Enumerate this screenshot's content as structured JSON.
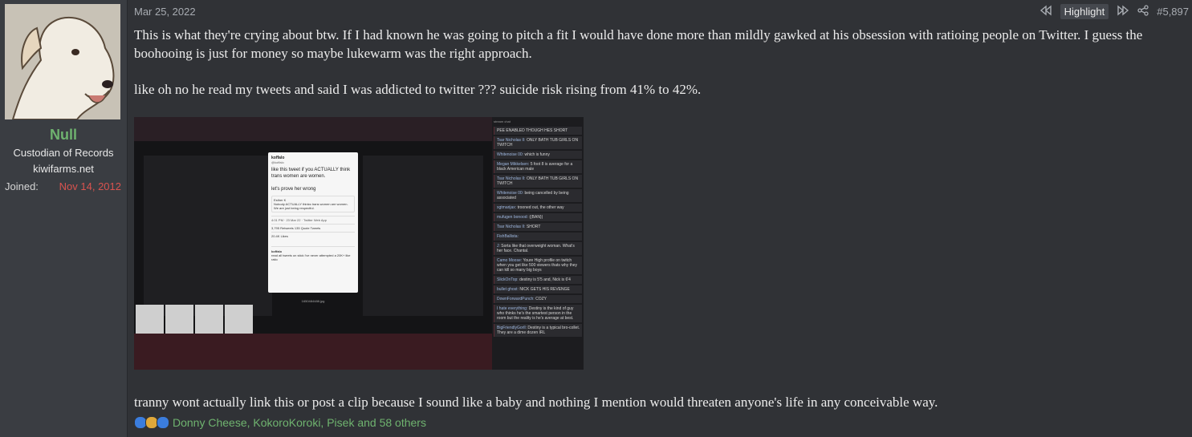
{
  "user": {
    "name": "Null",
    "title": "Custodian of Records",
    "blurb": "kiwifarms.net",
    "joined_label": "Joined:",
    "joined_value": "Nov 14, 2012"
  },
  "post": {
    "date": "Mar 25, 2022",
    "highlight_label": "Highlight",
    "post_number": "#5,897",
    "paragraph1": "This is what they're crying about btw. If I had known he was going to pitch a fit I would have done more than mildly gawked at his obsession with ratioing people on Twitter. I guess the boohooing is just for money so maybe lukewarm was the right approach.",
    "paragraph2": "like oh no he read my tweets and said I was addicted to twitter ??? suicide risk rising from 41% to 42%.",
    "paragraph3": "tranny wont actually link this or post a clip because I sound like a baby and nothing I mention would threaten anyone's life in any conceivable way."
  },
  "embed": {
    "tweet": {
      "name": "koffalo",
      "handle": "@koffalo",
      "body": "like this tweet if you ACTUALLY think trans women are women.",
      "body2": "let's prove her wrong",
      "quote_author": "Esther K",
      "quote_text": "Nobody ACTUALLY thinks trans women are women.",
      "quote_text2": "We are just being respectful.",
      "meta": "4:01 PM · 23 Mar 22 · Twitter Web App",
      "stats": "3,795 Retweets 135 Quote Tweets",
      "likes": "20.4K Likes",
      "reply_name": "koffalo",
      "reply_text": "read all tweets on stick i've never attempted a 20K+ like ratio"
    },
    "caption": "1650484488.jpg",
    "chat_header": "stream chat",
    "chat": [
      {
        "name": "",
        "text": "PEE ENABLED THOUGH HES SHORT"
      },
      {
        "name": "Tsar Nicholas II:",
        "text": "ONLY BATH TUB GIRLS ON TWITCH"
      },
      {
        "name": "Whitenoise 00:",
        "text": "which is funny"
      },
      {
        "name": "Megan Mikkelsen:",
        "text": "5 foot 8 is average for a black American male"
      },
      {
        "name": "Tsar Nicholas II:",
        "text": "ONLY BATH TUB GIRLS ON TWITCH"
      },
      {
        "name": "Whitenoise 00:",
        "text": "being cancelled by being associated"
      },
      {
        "name": "xgtmarijax:",
        "text": "trooned out, the other way"
      },
      {
        "name": "mufugen bonood:",
        "text": "((BAN))"
      },
      {
        "name": "Tsar Nicholas II:",
        "text": "SHORT"
      },
      {
        "name": "FishBallista:",
        "text": ""
      },
      {
        "name": "J:",
        "text": "Sorta like that overweight woman. What's her face. Chantal."
      },
      {
        "name": "Camo Moose:",
        "text": "Youre High profile on twitch when you get like 500 viewers thats why they can kill so many big boys"
      },
      {
        "name": "SlickOnTop:",
        "text": "destiny is 5'5 and, Nick is 6'4"
      },
      {
        "name": "bullet ghost:",
        "text": "NICK GETS HIS REVENGE"
      },
      {
        "name": "DownForwardPunch:",
        "text": "COZY"
      },
      {
        "name": "I hate everything:",
        "text": "Destiny is the kind of guy who thinks he's the smartest person in the room but the reality is he's average at best."
      },
      {
        "name": "BigFriendlyGorll:",
        "text": "Destiny is a typical bro-collet. They are a dime dozen IRL"
      }
    ]
  },
  "reactions": {
    "names": "Donny Cheese, KokoroKoroki, Pisek and 58 others"
  }
}
